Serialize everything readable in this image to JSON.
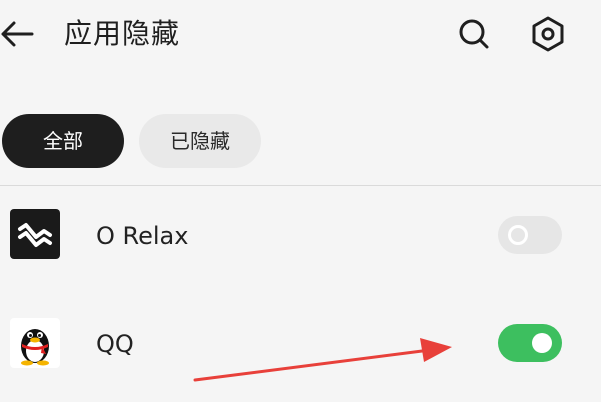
{
  "header": {
    "title": "应用隐藏"
  },
  "filters": [
    {
      "label": "全部",
      "selected": true
    },
    {
      "label": "已隐藏",
      "selected": false
    }
  ],
  "apps": [
    {
      "name": "O Relax",
      "icon": "o-relax-app-icon",
      "hidden": false
    },
    {
      "name": "QQ",
      "icon": "qq-penguin-app-icon",
      "hidden": true
    }
  ],
  "colors": {
    "toggle_on": "#3dbf5f",
    "toggle_off": "#e6e6e6",
    "chip_selected": "#1e1e1e",
    "chip_unselected": "#e9e9e9",
    "annotation_arrow": "#e8403a"
  },
  "icons": {
    "back": "arrow-left-icon",
    "search": "search-icon",
    "settings": "gear-icon"
  }
}
